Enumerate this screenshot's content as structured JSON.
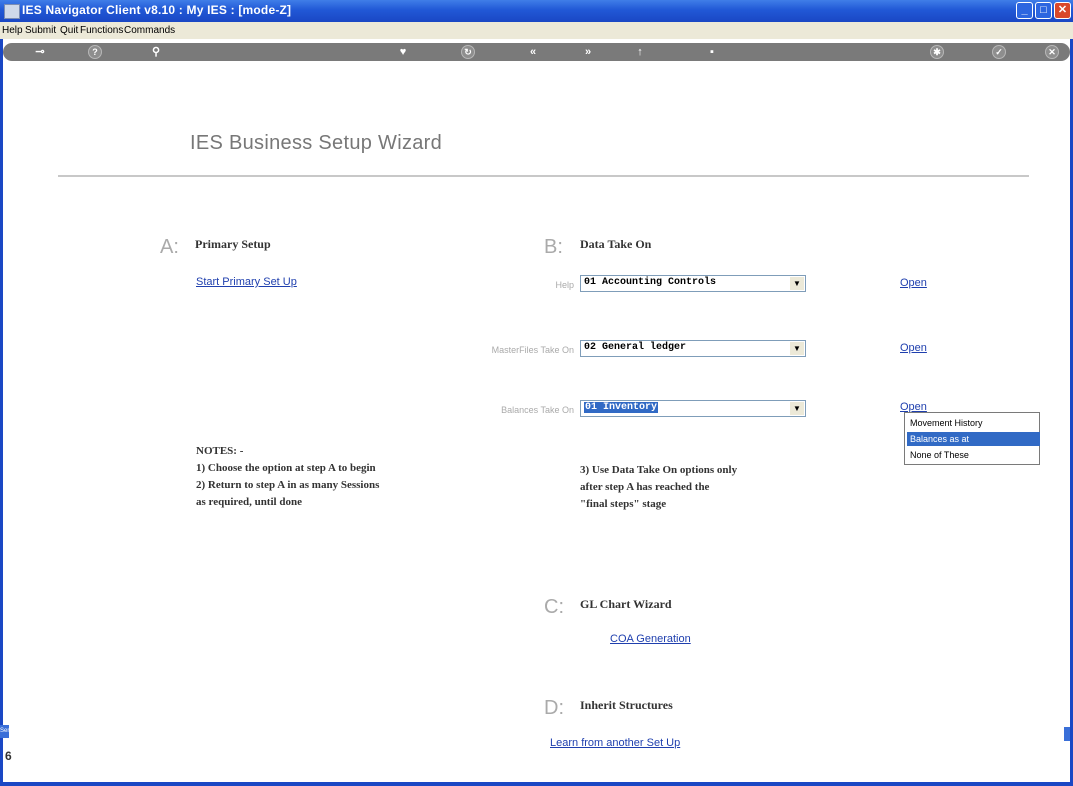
{
  "window": {
    "title": "IES Navigator Client v8.10 : My IES :      [mode-Z]"
  },
  "menu": [
    "Help",
    "Submit",
    "Quit",
    "Functions",
    "Commands"
  ],
  "wizard": {
    "title": "IES Business Setup Wizard",
    "section_a": {
      "letter": "A:",
      "heading": "Primary Setup",
      "link": "Start Primary Set Up"
    },
    "section_b": {
      "letter": "B:",
      "heading": "Data Take On",
      "rows": [
        {
          "label": "Help",
          "value": "01 Accounting Controls",
          "open": "Open"
        },
        {
          "label": "MasterFiles Take On",
          "value": "02 General ledger",
          "open": "Open"
        },
        {
          "label": "Balances Take On",
          "value": "01 Inventory",
          "open": "Open"
        }
      ]
    },
    "notes_left": "NOTES: -\n1) Choose the option at step A to begin\n2) Return to step A in as many Sessions\nas required, until done",
    "notes_right": "3) Use Data Take On options only\nafter step A has reached the\n\"final steps\" stage",
    "section_c": {
      "letter": "C:",
      "heading": "GL Chart Wizard",
      "link": "COA Generation"
    },
    "section_d": {
      "letter": "D:",
      "heading": "Inherit Structures",
      "link": "Learn from another Set Up"
    }
  },
  "popup": {
    "items": [
      "Movement History",
      "Balances as at",
      "None of These"
    ],
    "selected": "Balances as at"
  },
  "side": {
    "left_tab": "Ser",
    "left_char": "6"
  }
}
